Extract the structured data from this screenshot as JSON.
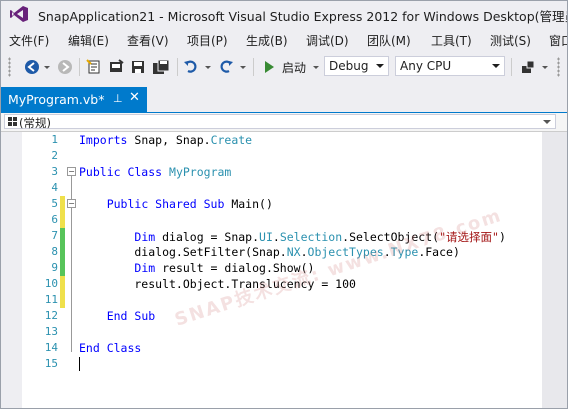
{
  "window": {
    "title": "SnapApplication21 - Microsoft Visual Studio Express 2012 for Windows Desktop(管理员)"
  },
  "menu": {
    "items": [
      "文件(F)",
      "编辑(E)",
      "查看(V)",
      "项目(P)",
      "生成(B)",
      "调试(D)",
      "团队(M)",
      "工具(T)",
      "测试(S)",
      "窗口"
    ]
  },
  "toolbar": {
    "start_label": "启动",
    "config": "Debug",
    "platform": "Any CPU"
  },
  "tab": {
    "label": "MyProgram.vb*",
    "pin": "⊥",
    "close": "✕"
  },
  "navbar": {
    "scope": "(常规)"
  },
  "editor": {
    "line_numbers": [
      "1",
      "2",
      "3",
      "4",
      "5",
      "6",
      "7",
      "8",
      "9",
      "10",
      "11",
      "12",
      "13",
      "14",
      "15"
    ],
    "colors": {
      "keyword": "#0000ff",
      "type": "#2b91af",
      "string": "#a31515",
      "changed_saved": "#57c45a",
      "changed_unsaved": "#efe04b"
    }
  },
  "watermark": "SNAP技术交流: www.NX78.com"
}
